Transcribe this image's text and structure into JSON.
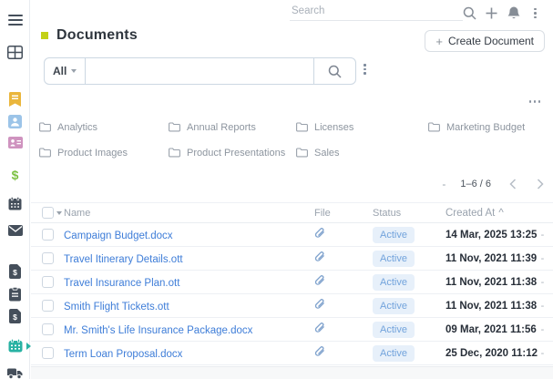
{
  "colors": {
    "accent_square": "#c3d117",
    "link": "#3e7dd8",
    "badge_bg": "#e7f0fa",
    "badge_text": "#72a3dc",
    "sidebar_active": "#28b2a3"
  },
  "sidebar": {
    "icons": [
      "hamburger-menu-icon",
      "grid-icon",
      "bookmark-icon",
      "user-badge-icon",
      "contact-card-icon",
      "dollar-icon",
      "calendar-icon",
      "envelope-icon",
      "invoice-icon",
      "clipboard-icon",
      "receipt-icon",
      "documents-calendar-icon",
      "truck-icon"
    ],
    "active_item": "documents-calendar-icon"
  },
  "topbar": {
    "search_placeholder": "Search",
    "icons": [
      "search-icon",
      "plus-icon",
      "bell-icon",
      "kebab-icon"
    ]
  },
  "page": {
    "title": "Documents",
    "create_button": {
      "plus": "+",
      "label": "Create Document"
    }
  },
  "filter": {
    "scope": "All",
    "search_value": ""
  },
  "folders": [
    "Analytics",
    "Annual Reports",
    "Licenses",
    "Marketing Budget",
    "Product Images",
    "Product Presentations",
    "Sales"
  ],
  "pagination": {
    "dash": "-",
    "range": "1–6 / 6"
  },
  "table": {
    "headers": {
      "name": "Name",
      "file": "File",
      "status": "Status",
      "created": "Created At",
      "sort": "^"
    },
    "row_menu_dash": "-",
    "rows": [
      {
        "name": "Campaign Budget.docx",
        "status": "Active",
        "created": "14 Mar, 2025 13:25"
      },
      {
        "name": "Travel Itinerary Details.ott",
        "status": "Active",
        "created": "11 Nov, 2021 11:39"
      },
      {
        "name": "Travel Insurance Plan.ott",
        "status": "Active",
        "created": "11 Nov, 2021 11:38"
      },
      {
        "name": "Smith Flight Tickets.ott",
        "status": "Active",
        "created": "11 Nov, 2021 11:38"
      },
      {
        "name": "Mr. Smith's Life Insurance Package.docx",
        "status": "Active",
        "created": "09 Mar, 2021 11:56"
      },
      {
        "name": "Term Loan Proposal.docx",
        "status": "Active",
        "created": "25 Dec, 2020 11:12"
      }
    ]
  }
}
